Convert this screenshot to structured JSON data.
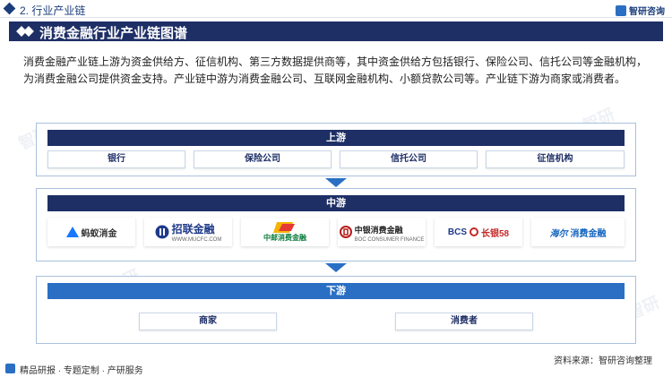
{
  "header": {
    "section": "2. 行业产业链",
    "brand": "智研咨询"
  },
  "title": "消费金融行业产业链图谱",
  "intro": "消费金融产业链上游为资金供给方、征信机构、第三方数据提供商等，其中资金供给方包括银行、保险公司、信托公司等金融机构，为消费金融公司提供资金支持。产业链中游为消费金融公司、互联网金融机构、小额贷款公司等。产业链下游为商家或消费者。",
  "upstream": {
    "label": "上游",
    "items": [
      "银行",
      "保险公司",
      "信托公司",
      "征信机构"
    ]
  },
  "midstream": {
    "label": "中游",
    "logos": [
      {
        "name": "蚂蚁消金",
        "icon": "ant-logo-icon",
        "color": "#1677ff"
      },
      {
        "name": "招联金融",
        "sub": "WWW.MUCFC.COM",
        "icon": "zhaolian-logo-icon",
        "color": "#1e3a8a"
      },
      {
        "name": "中邮消费金融",
        "icon": "youzheng-logo-icon",
        "color": "#0a7a3a"
      },
      {
        "name": "中银消费金融",
        "sub": "BOC CONSUMER FINANCE",
        "icon": "boc-logo-icon",
        "color": "#b71c1c"
      },
      {
        "name": "长银58",
        "prefix": "BCS",
        "icon": "changyin-logo-icon",
        "color": "#c62828"
      },
      {
        "name": "消费金融",
        "prefix": "海尔",
        "icon": "haier-logo-icon",
        "color": "#1565c0"
      }
    ]
  },
  "downstream": {
    "label": "下游",
    "items": [
      "商家",
      "消费者"
    ]
  },
  "source": "资料来源：智研咨询整理",
  "footer": "精品研报 · 专题定制 · 产研服务",
  "colors": {
    "navy": "#1e2f66",
    "blue": "#2a6fc4",
    "border": "#a9c0dd"
  }
}
